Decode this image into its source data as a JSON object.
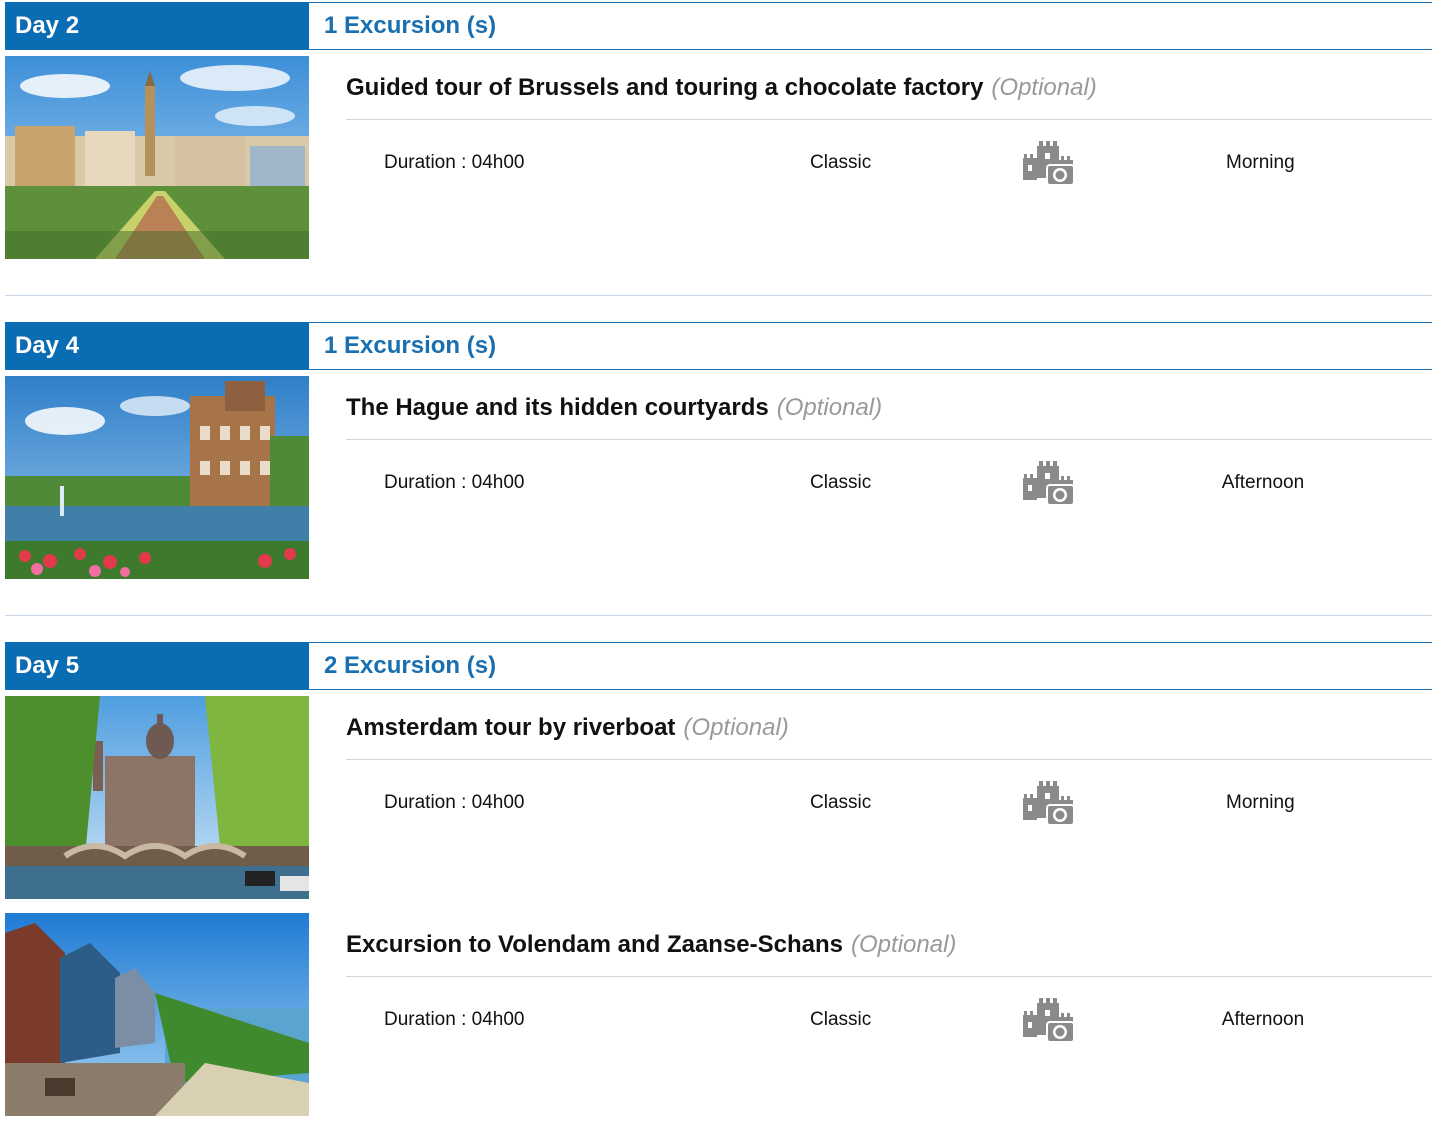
{
  "days": [
    {
      "day_label": "Day 2",
      "excursion_count": "1 Excursion (s)",
      "excursions": [
        {
          "title": "Guided tour of Brussels and touring a chocolate factory",
          "optional": "(Optional)",
          "duration": "Duration : 04h00",
          "level": "Classic",
          "category_icon": "castle-camera-icon",
          "time_of_day": "Morning"
        }
      ]
    },
    {
      "day_label": "Day 4",
      "excursion_count": "1 Excursion (s)",
      "excursions": [
        {
          "title": "The Hague and its hidden courtyards",
          "optional": "(Optional)",
          "duration": "Duration : 04h00",
          "level": "Classic",
          "category_icon": "castle-camera-icon",
          "time_of_day": "Afternoon"
        }
      ]
    },
    {
      "day_label": "Day 5",
      "excursion_count": "2 Excursion (s)",
      "excursions": [
        {
          "title": "Amsterdam tour by riverboat",
          "optional": "(Optional)",
          "duration": "Duration : 04h00",
          "level": "Classic",
          "category_icon": "castle-camera-icon",
          "time_of_day": "Morning"
        },
        {
          "title": "Excursion to Volendam and Zaanse-Schans",
          "optional": "(Optional)",
          "duration": "Duration : 04h00",
          "level": "Classic",
          "category_icon": "castle-camera-icon",
          "time_of_day": "Afternoon"
        }
      ]
    }
  ],
  "colors": {
    "header_blue": "#0a6cb3",
    "count_blue": "#1a6fb0",
    "optional_gray": "#999999",
    "icon_gray": "#8a8a8a"
  }
}
